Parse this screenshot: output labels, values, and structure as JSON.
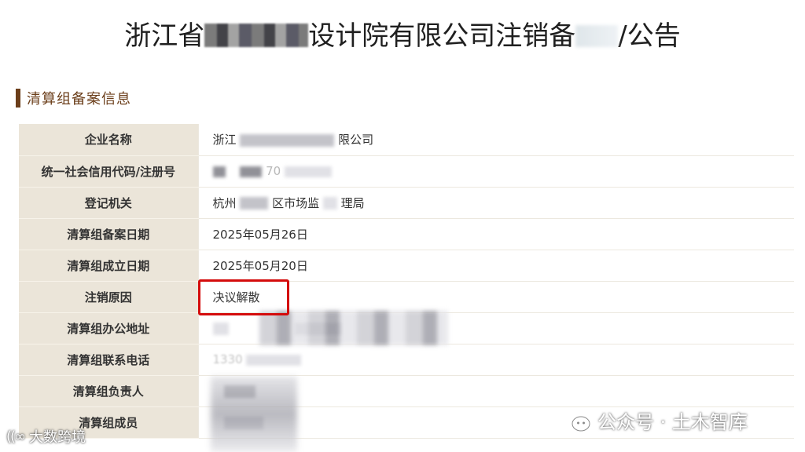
{
  "header": {
    "title_prefix": "浙江省",
    "title_suffix": "设计院有限公司注销备",
    "title_end": "/公告"
  },
  "section": {
    "title": "清算组备案信息"
  },
  "rows": [
    {
      "label": "企业名称",
      "value_prefix": "浙江",
      "value_suffix": "限公司"
    },
    {
      "label": "统一社会信用代码/注册号",
      "value_prefix": "",
      "value_suffix": "70"
    },
    {
      "label": "登记机关",
      "value_prefix": "杭州",
      "value_suffix": "区市场监",
      "value_end": "理局"
    },
    {
      "label": "清算组备案日期",
      "value_prefix": "2025年05月26日",
      "value_suffix": ""
    },
    {
      "label": "清算组成立日期",
      "value_prefix": "2025年05月20日",
      "value_suffix": ""
    },
    {
      "label": "注销原因",
      "value_prefix": "决议解散",
      "value_suffix": ""
    },
    {
      "label": "清算组办公地址",
      "value_prefix": "",
      "value_suffix": ""
    },
    {
      "label": "清算组联系电话",
      "value_prefix": "1330",
      "value_suffix": ""
    },
    {
      "label": "清算组负责人",
      "value_prefix": "",
      "value_suffix": ""
    },
    {
      "label": "清算组成员",
      "value_prefix": "",
      "value_suffix": ""
    }
  ],
  "watermarks": {
    "left_logo": "((∞",
    "left_text": "大数跨境",
    "right_text": "公众号 · 土木智库"
  },
  "colors": {
    "section_accent": "#6b3e1a",
    "label_bg": "#ebe5d9",
    "highlight_border": "#d40c0c"
  }
}
